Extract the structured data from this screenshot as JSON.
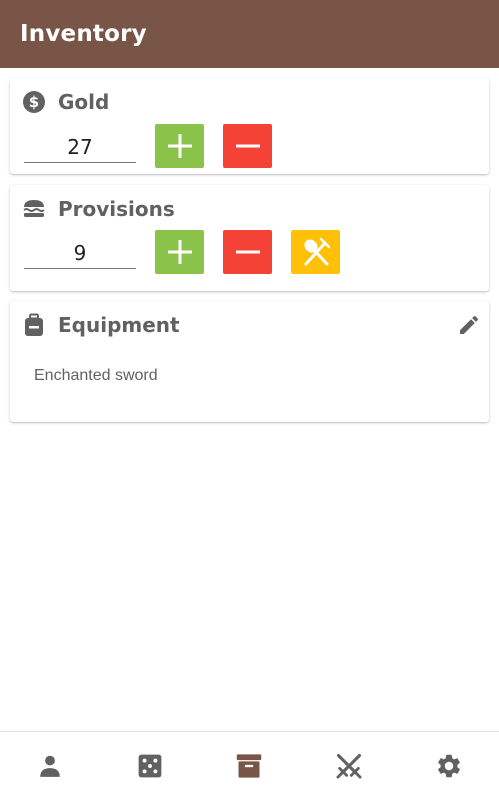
{
  "appbar": {
    "title": "Inventory",
    "color": "#795548"
  },
  "gold": {
    "title": "Gold",
    "icon": "dollar-circle-icon",
    "value": "27",
    "plus": "plus-icon",
    "minus": "minus-icon"
  },
  "provisions": {
    "title": "Provisions",
    "icon": "burger-icon",
    "value": "9",
    "plus": "plus-icon",
    "minus": "minus-icon",
    "eat": "utensils-icon"
  },
  "equipment": {
    "title": "Equipment",
    "icon": "backpack-icon",
    "edit": "pencil-icon",
    "items_text": "Enchanted sword"
  },
  "bottom_nav": {
    "items": [
      {
        "icon": "person-icon",
        "active": false
      },
      {
        "icon": "dice-icon",
        "active": false
      },
      {
        "icon": "archive-box-icon",
        "active": true
      },
      {
        "icon": "crossed-swords-icon",
        "active": false
      },
      {
        "icon": "gear-icon",
        "active": false
      }
    ]
  },
  "colors": {
    "plus": "#8bc34a",
    "minus": "#f44336",
    "eat": "#ffc107",
    "icon": "#616161",
    "active": "#795548"
  }
}
